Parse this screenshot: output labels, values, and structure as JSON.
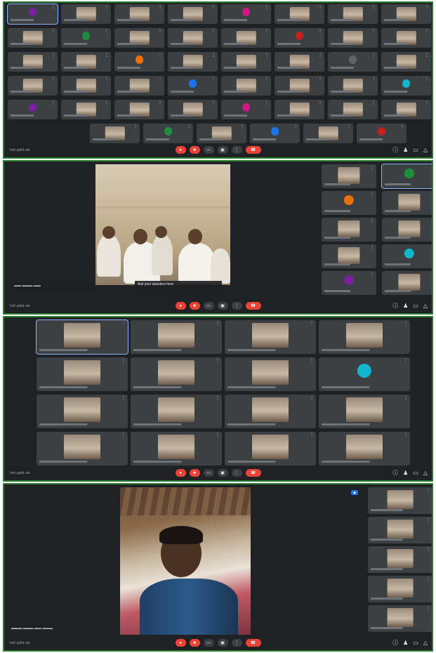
{
  "colors": {
    "panel_bg": "#202124",
    "tile_bg": "#3c4043",
    "panel_border": "#2e7d32",
    "hangup": "#ea4335",
    "accent": "#1a73e8"
  },
  "icons": {
    "mic": "mic-icon",
    "camera": "camera-icon",
    "captions": "captions-icon",
    "present": "present-icon",
    "more": "more-vert-icon",
    "hangup": "call-end-icon",
    "info": "info-icon",
    "people": "people-icon",
    "chat": "chat-icon",
    "activities": "activities-icon"
  },
  "panel1": {
    "meeting_code": "hxh-ypkb-uts"
  },
  "panel2": {
    "meeting_code": "hxh-ypkb-uts",
    "caption": "Ask your question here"
  },
  "panel3": {
    "meeting_code": "hxh-ypkb-uts"
  },
  "panel4": {
    "meeting_code": "hxh-ypkb-uts"
  }
}
